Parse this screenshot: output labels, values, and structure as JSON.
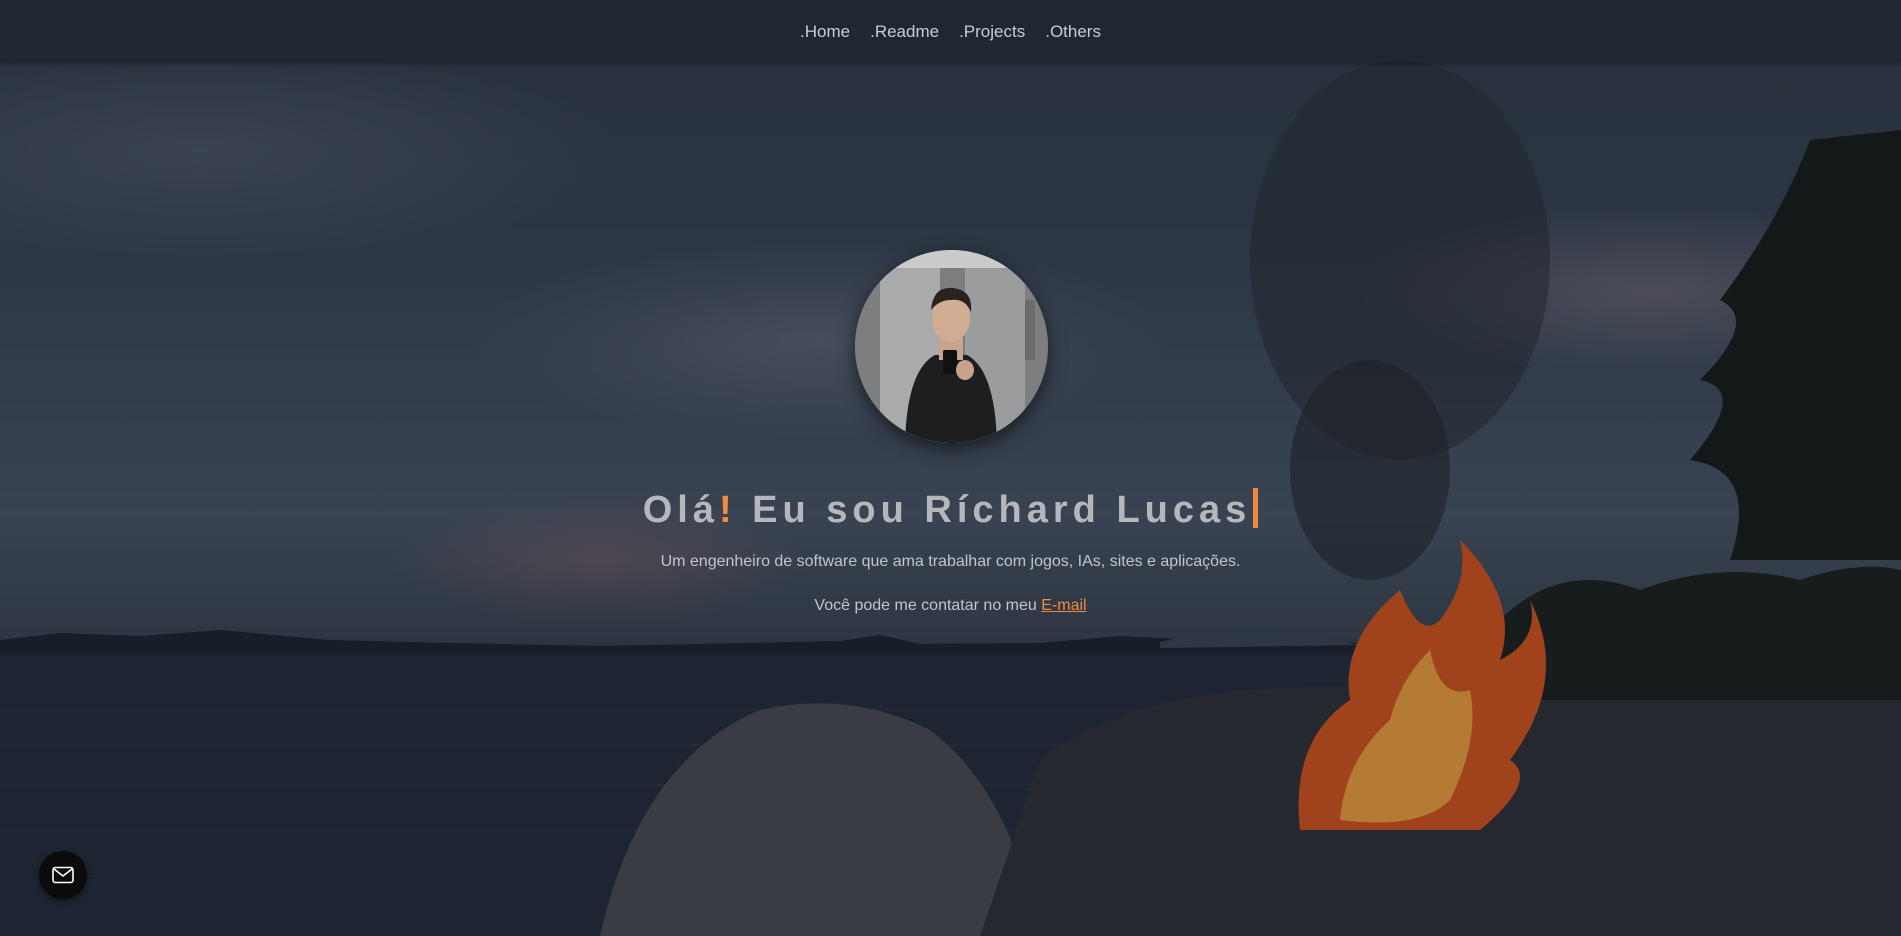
{
  "nav": {
    "items": [
      {
        "label": ".Home"
      },
      {
        "label": ".Readme"
      },
      {
        "label": ".Projects"
      },
      {
        "label": ".Others"
      }
    ]
  },
  "hero": {
    "headline_prefix": "Olá",
    "headline_exclaim": "!",
    "headline_rest": " Eu sou Ríchard Lucas",
    "tagline": "Um engenheiro de software que ama trabalhar com jogos, IAs, sites e aplicações.",
    "contact_text": "Você pode me contatar no meu ",
    "email_label": "E-mail"
  },
  "fab": {
    "icon": "mail-icon"
  },
  "colors": {
    "accent": "#f08a3e",
    "nav_bg": "#1e2430",
    "text": "#c2c5cc"
  }
}
